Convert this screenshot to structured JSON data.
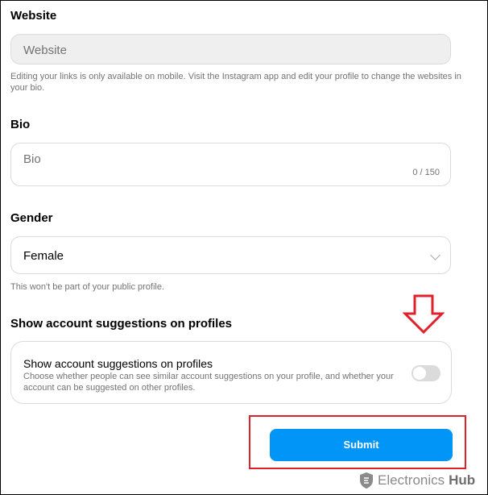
{
  "website": {
    "heading": "Website",
    "placeholder": "Website",
    "hint": "Editing your links is only available on mobile. Visit the Instagram app and edit your profile to change the websites in your bio."
  },
  "bio": {
    "heading": "Bio",
    "placeholder": "Bio",
    "counter": "0 / 150"
  },
  "gender": {
    "heading": "Gender",
    "selected": "Female",
    "hint": "This won't be part of your public profile."
  },
  "suggestions": {
    "heading": "Show account suggestions on profiles",
    "label": "Show account suggestions on profiles",
    "description": "Choose whether people can see similar account suggestions on your profile, and whether your account can be suggested on other profiles.",
    "enabled": false
  },
  "submit": {
    "label": "Submit"
  },
  "watermark": {
    "brand": "Electronics",
    "suffix": "Hub"
  },
  "colors": {
    "accent": "#0095f6",
    "annotation": "#e0202a"
  }
}
